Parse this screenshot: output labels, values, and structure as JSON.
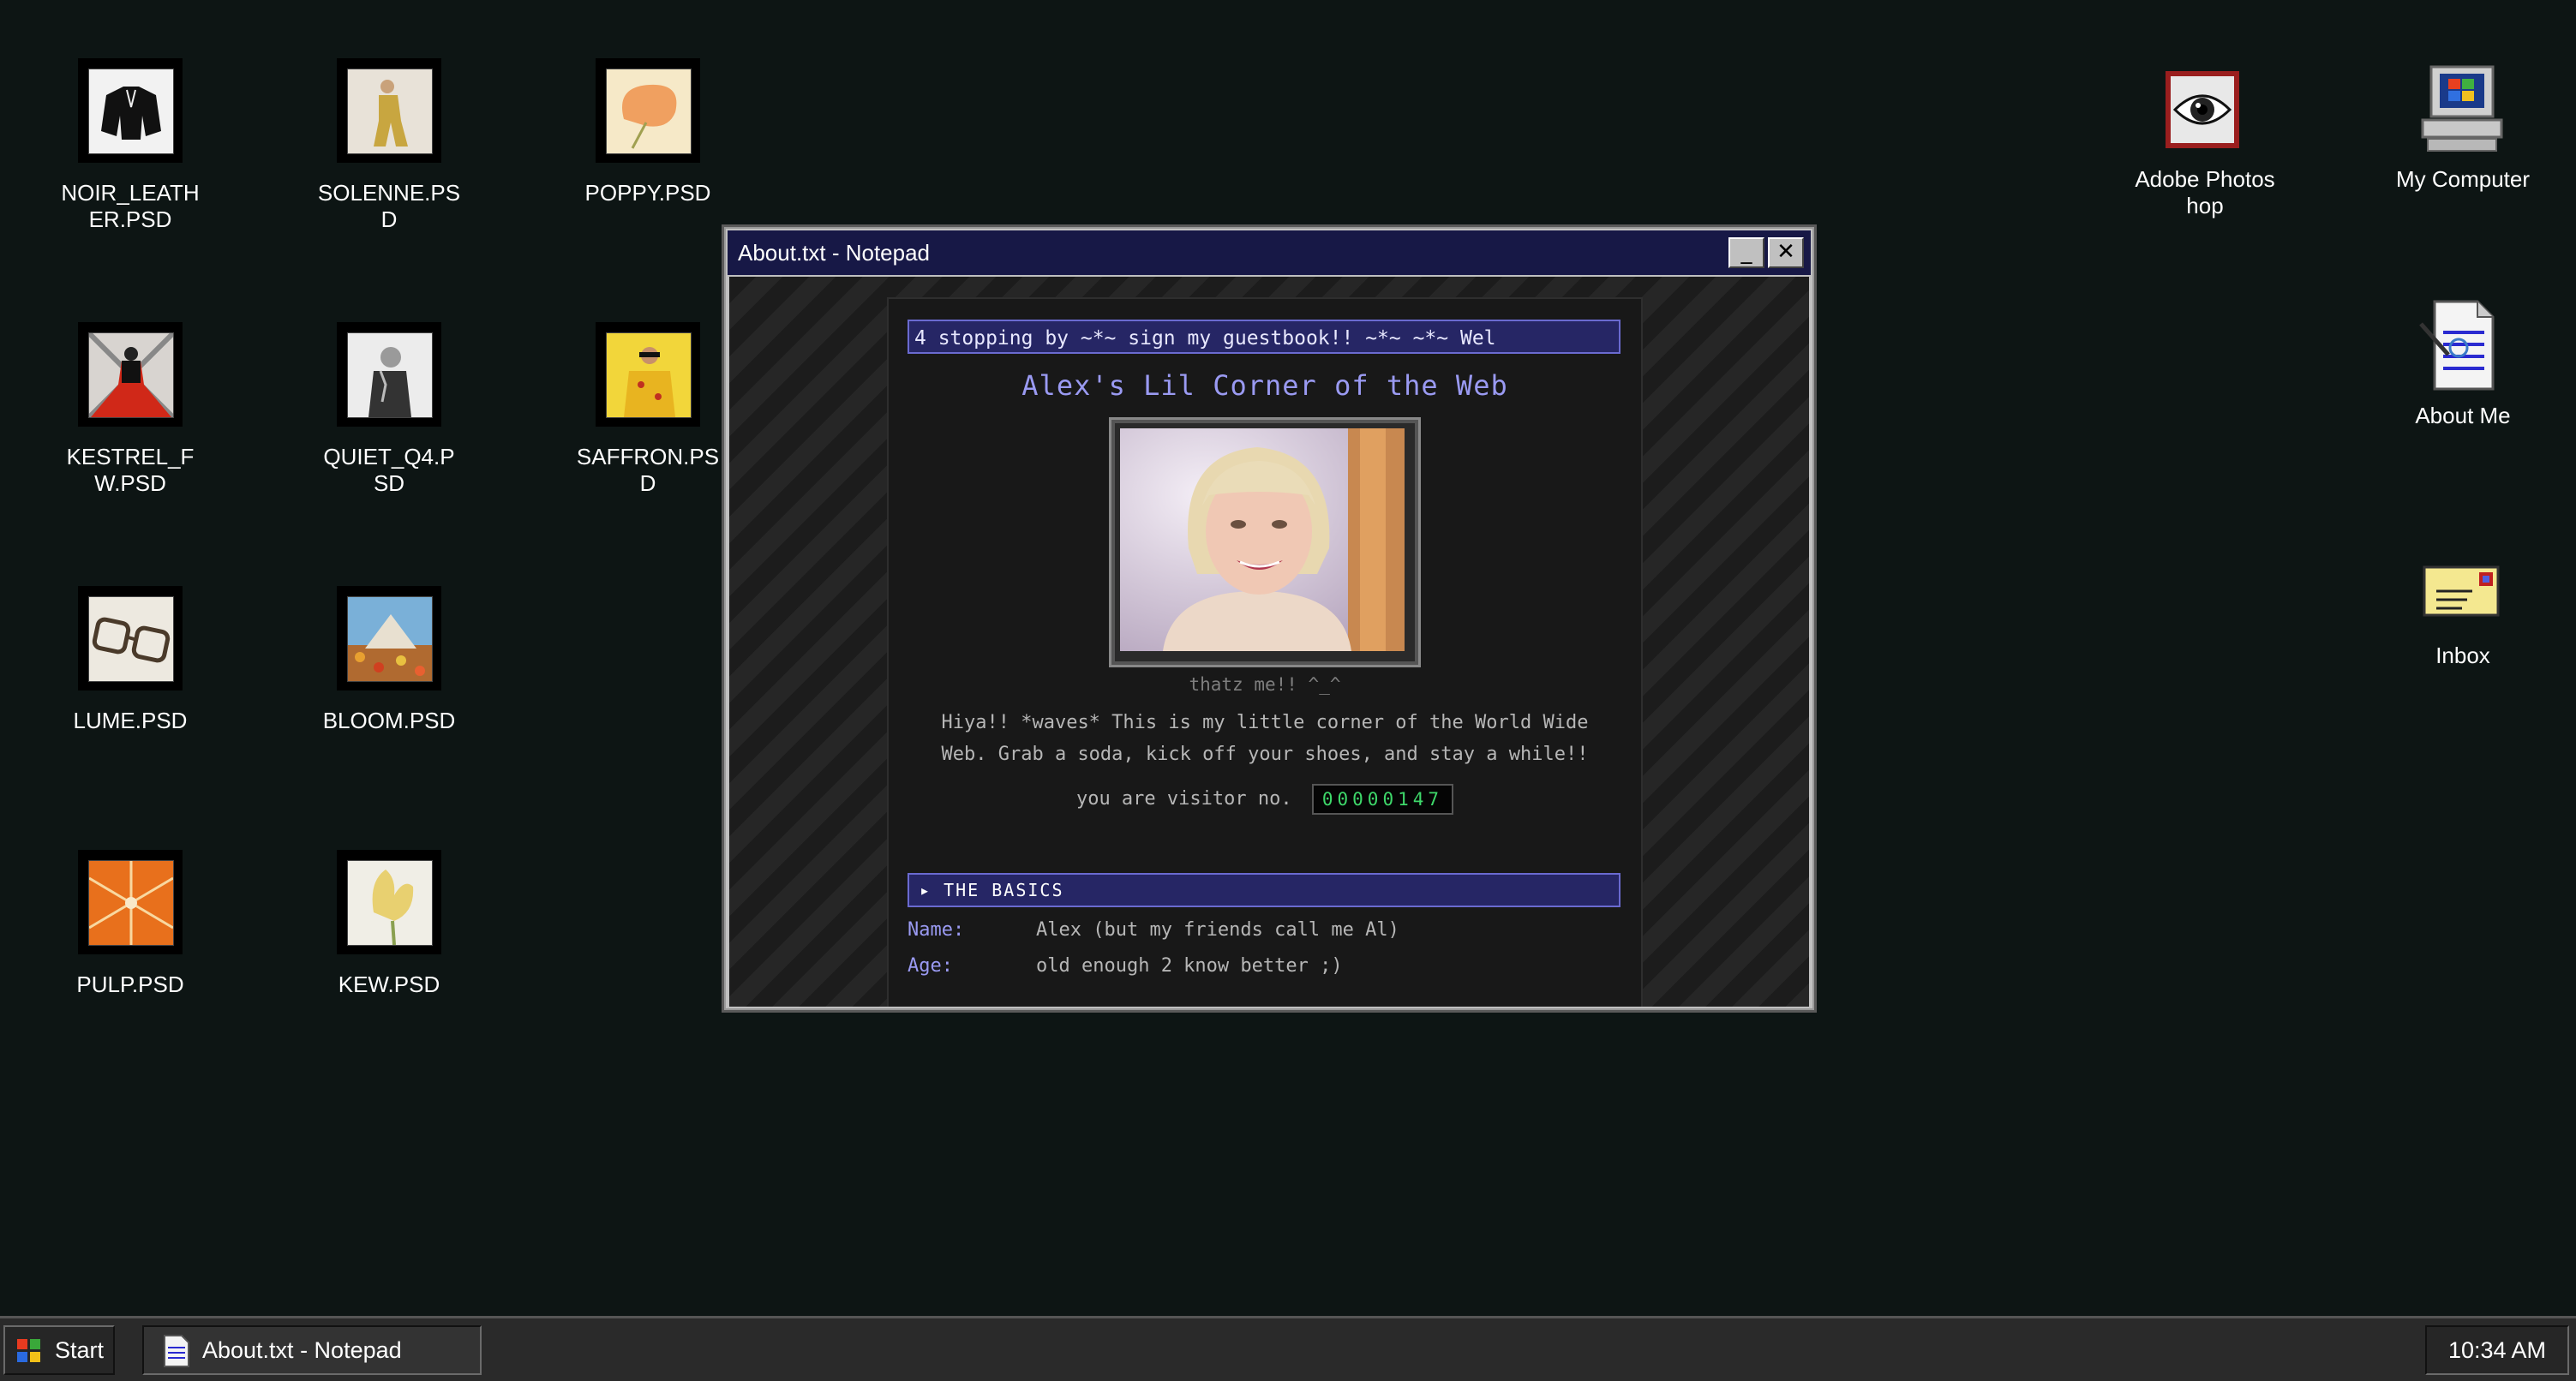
{
  "desktop": {
    "icons": [
      {
        "label": "NOIR_LEATHER.PSD"
      },
      {
        "label": "SOLENNE.PSD"
      },
      {
        "label": "POPPY.PSD"
      },
      {
        "label": "KESTREL_FW.PSD"
      },
      {
        "label": "QUIET_Q4.PSD"
      },
      {
        "label": "SAFFRON.PSD"
      },
      {
        "label": "LUME.PSD"
      },
      {
        "label": "BLOOM.PSD"
      },
      {
        "label": "PULP.PSD"
      },
      {
        "label": "KEW.PSD"
      }
    ],
    "system_icons": [
      {
        "label": "Adobe Photoshop",
        "icon": "photoshop-eye-icon"
      },
      {
        "label": "My Computer",
        "icon": "computer-icon"
      },
      {
        "label": "About Me",
        "icon": "document-icon"
      },
      {
        "label": "Inbox",
        "icon": "envelope-icon"
      }
    ]
  },
  "window": {
    "title": "About.txt - Notepad",
    "minimize_label": "_",
    "close_label": "✕",
    "page": {
      "marquee": "4 stopping by ~*~ sign my guestbook!! ~*~   ~*~ Wel",
      "heading": "Alex's Lil Corner of the Web",
      "caption": "thatz me!! ^_^",
      "intro_line1": "Hiya!! *waves* This is my little corner of the World Wide",
      "intro_line2": "Web. Grab a soda, kick off your shoes, and stay a while!!",
      "visitor_label": "you are visitor no.",
      "visitor_count": "00000147",
      "section_title": "▸ THE BASICS",
      "basics": [
        {
          "key": "Name:",
          "value": "Alex (but my friends call me Al)"
        },
        {
          "key": "Age:",
          "value": "old enough 2 know better ;)"
        }
      ]
    }
  },
  "taskbar": {
    "start_label": "Start",
    "task_label": "About.txt - Notepad",
    "clock": "10:34 AM"
  }
}
